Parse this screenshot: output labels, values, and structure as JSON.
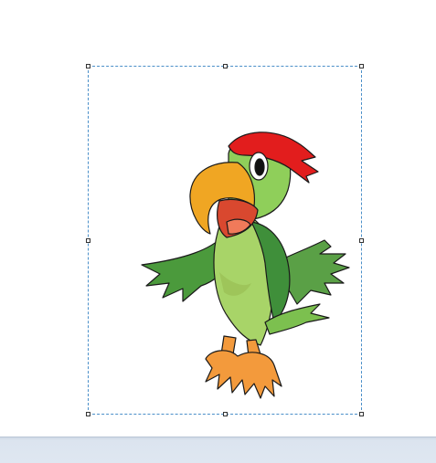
{
  "image": {
    "subject": "parrot-clipart",
    "accessories": [
      "red-bandana"
    ]
  },
  "selection": {
    "style": "dashed",
    "handles": [
      "top-left",
      "top-center",
      "top-right",
      "middle-left",
      "middle-right",
      "bottom-left",
      "bottom-center",
      "bottom-right"
    ]
  },
  "colors": {
    "canvas": "#ffffff",
    "selection_border": "#4a8fc9",
    "bottom_bar": "#dfe7f1",
    "parrot_dark_green": "#3f8f3a",
    "parrot_light_green": "#a8d468",
    "beak": "#f0a623",
    "bandana": "#e21d1d",
    "feet": "#f39a3c"
  }
}
